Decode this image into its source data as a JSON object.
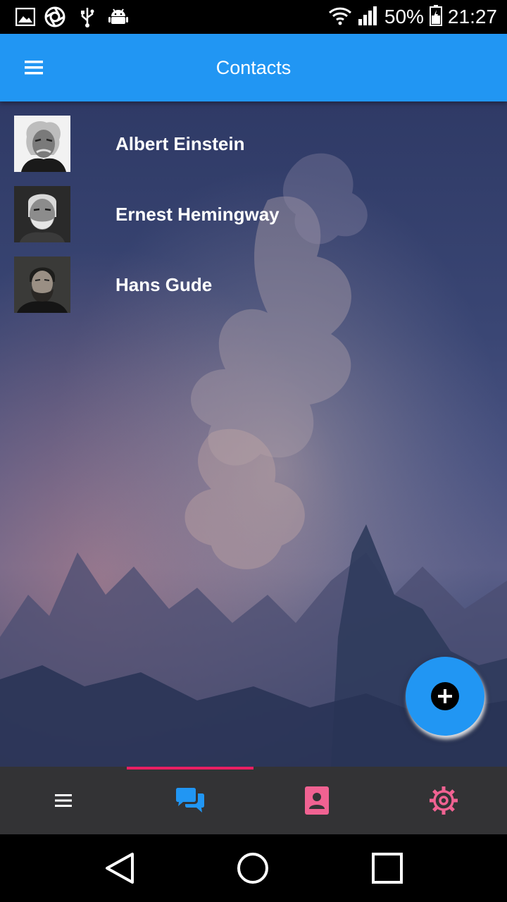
{
  "status_bar": {
    "battery": "50%",
    "time": "21:27",
    "icons": [
      "image-icon",
      "aperture-icon",
      "usb-icon",
      "android-icon",
      "wifi-icon",
      "signal-icon",
      "battery-icon"
    ]
  },
  "app_bar": {
    "title": "Contacts",
    "menu_icon": "menu-icon"
  },
  "contacts": [
    {
      "name": "Albert Einstein"
    },
    {
      "name": "Ernest Hemingway"
    },
    {
      "name": "Hans Gude"
    }
  ],
  "fab": {
    "icon": "add-icon"
  },
  "tabs": [
    {
      "icon": "menu-icon",
      "color": "#ffffff",
      "selected": false
    },
    {
      "icon": "chat-icon",
      "color": "#2196f3",
      "selected": true
    },
    {
      "icon": "contact-card-icon",
      "color": "#f06292",
      "selected": false
    },
    {
      "icon": "gear-icon",
      "color": "#f06292",
      "selected": false
    }
  ],
  "colors": {
    "primary": "#2196f3",
    "accent": "#e91e63",
    "tab_bar_bg": "#333335"
  }
}
